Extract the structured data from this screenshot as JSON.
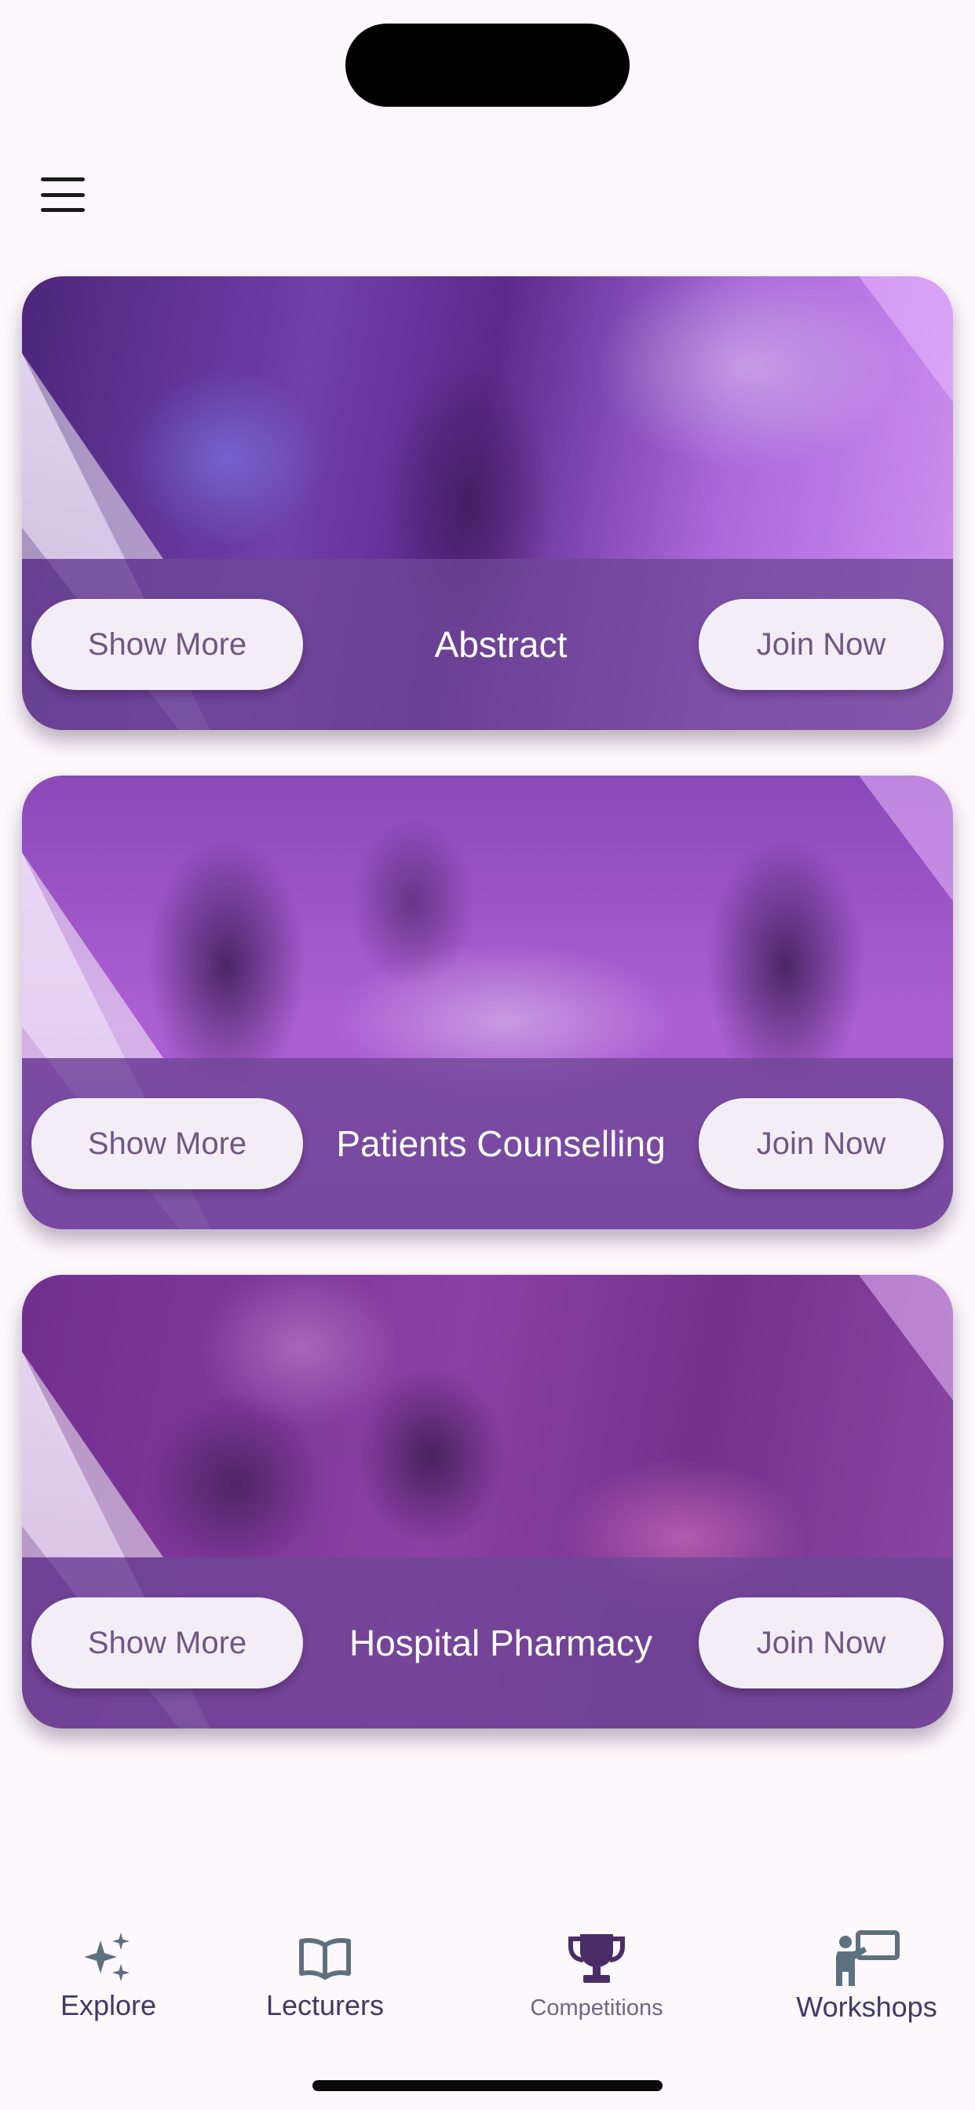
{
  "header": {
    "menu_icon": "hamburger-menu-icon"
  },
  "cards": [
    {
      "title": "Abstract",
      "show_more_label": "Show More",
      "join_now_label": "Join Now"
    },
    {
      "title": "Patients Counselling",
      "show_more_label": "Show More",
      "join_now_label": "Join Now"
    },
    {
      "title": "Hospital Pharmacy",
      "show_more_label": "Show More",
      "join_now_label": "Join Now"
    }
  ],
  "tabbar": {
    "tabs": [
      {
        "label": "Explore",
        "icon": "sparkles-icon"
      },
      {
        "label": "Lecturers",
        "icon": "open-book-icon"
      },
      {
        "label": "Competitions",
        "icon": "trophy-icon",
        "active": true
      },
      {
        "label": "Workshops",
        "icon": "presenter-board-icon"
      }
    ]
  },
  "colors": {
    "background": "#fdf8fc",
    "card_bar": "#6e4696",
    "pill_background": "#f3eef6",
    "pill_text": "#6f5783",
    "tab_label": "#3f3a66",
    "tab_icon": "#5d7080",
    "competitions_icon": "#4a2d66"
  }
}
